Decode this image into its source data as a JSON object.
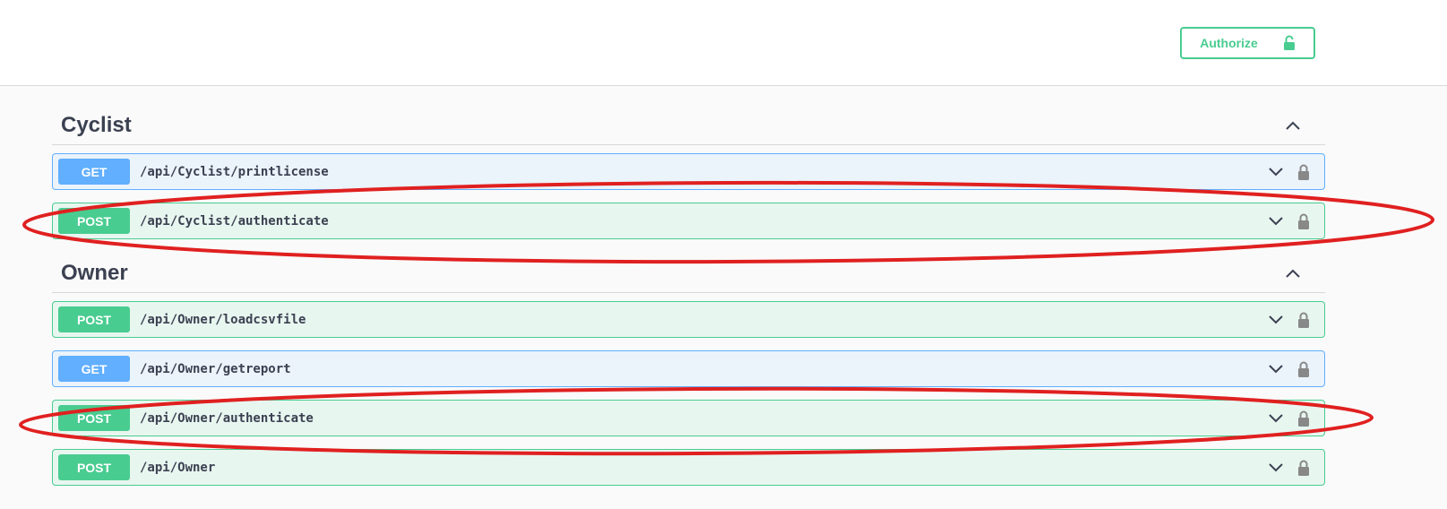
{
  "topbar": {
    "authorize_label": "Authorize",
    "authorize_icon": "unlocked-lock-icon"
  },
  "sections": [
    {
      "title": "Cyclist",
      "expanded": true,
      "operations": [
        {
          "method": "GET",
          "path": "/api/Cyclist/printlicense",
          "highlighted": false
        },
        {
          "method": "POST",
          "path": "/api/Cyclist/authenticate",
          "highlighted": true
        }
      ]
    },
    {
      "title": "Owner",
      "expanded": true,
      "operations": [
        {
          "method": "POST",
          "path": "/api/Owner/loadcsvfile",
          "highlighted": false
        },
        {
          "method": "GET",
          "path": "/api/Owner/getreport",
          "highlighted": false
        },
        {
          "method": "POST",
          "path": "/api/Owner/authenticate",
          "highlighted": true
        },
        {
          "method": "POST",
          "path": "/api/Owner",
          "highlighted": false
        }
      ]
    }
  ],
  "colors": {
    "get": "#61affe",
    "post": "#49cc90",
    "highlight_annotation": "#e02020"
  },
  "icons": {
    "section_toggle": "chevron-up-icon",
    "operation_toggle": "chevron-down-icon",
    "operation_lock": "lock-icon"
  }
}
